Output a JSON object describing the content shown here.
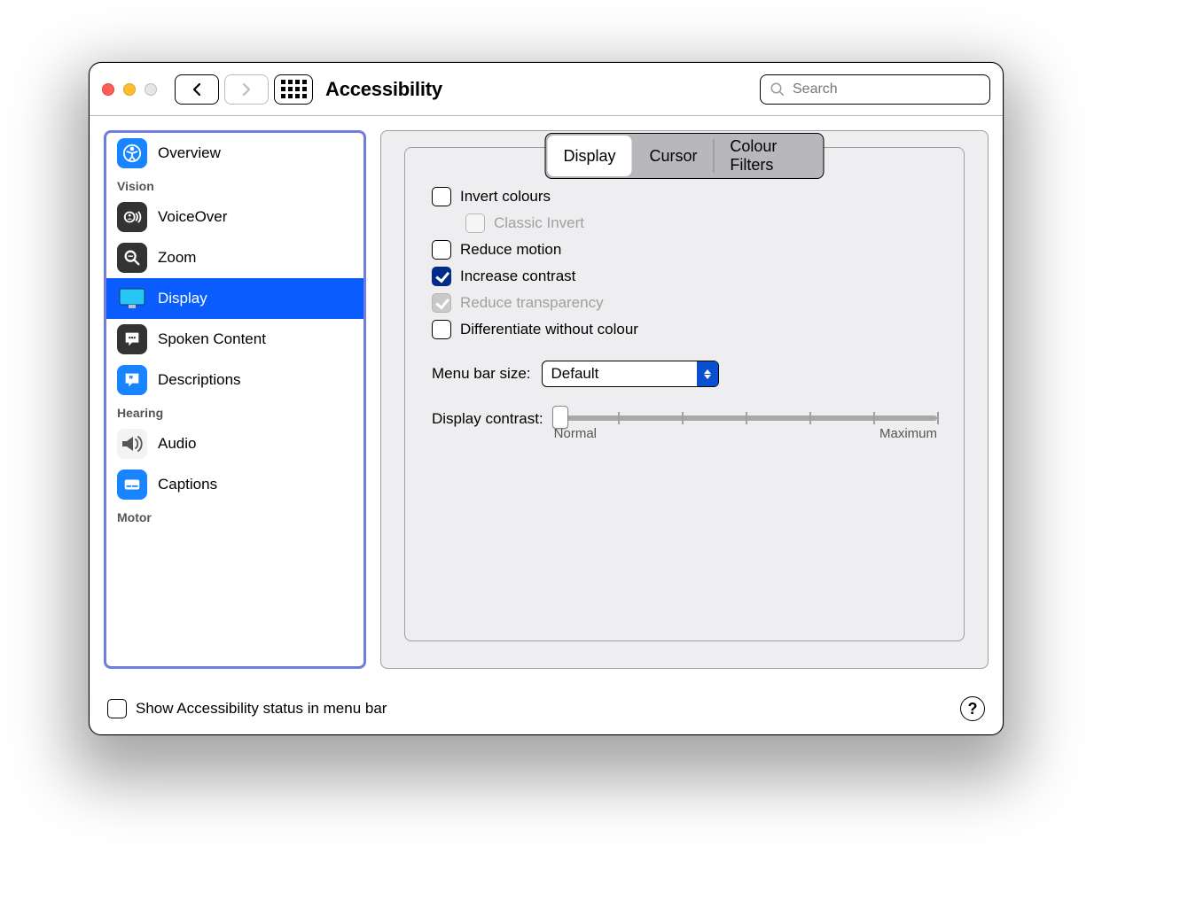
{
  "window": {
    "title": "Accessibility"
  },
  "search": {
    "placeholder": "Search"
  },
  "sidebar": {
    "sections": [
      {
        "items": [
          {
            "label": "Overview",
            "icon": "overview",
            "selected": false
          }
        ]
      },
      {
        "label": "Vision",
        "items": [
          {
            "label": "VoiceOver",
            "icon": "voiceover",
            "selected": false
          },
          {
            "label": "Zoom",
            "icon": "zoom",
            "selected": false
          },
          {
            "label": "Display",
            "icon": "display",
            "selected": true
          },
          {
            "label": "Spoken Content",
            "icon": "spoken",
            "selected": false
          },
          {
            "label": "Descriptions",
            "icon": "descriptions",
            "selected": false
          }
        ]
      },
      {
        "label": "Hearing",
        "items": [
          {
            "label": "Audio",
            "icon": "audio",
            "selected": false
          },
          {
            "label": "Captions",
            "icon": "captions",
            "selected": false
          }
        ]
      },
      {
        "label": "Motor",
        "items": []
      }
    ]
  },
  "tabs": [
    {
      "label": "Display",
      "selected": true
    },
    {
      "label": "Cursor",
      "selected": false
    },
    {
      "label": "Colour Filters",
      "selected": false
    }
  ],
  "options": {
    "invert_colours": {
      "label": "Invert colours",
      "checked": false
    },
    "classic_invert": {
      "label": "Classic Invert",
      "checked": false,
      "disabled": true
    },
    "reduce_motion": {
      "label": "Reduce motion",
      "checked": false
    },
    "increase_contrast": {
      "label": "Increase contrast",
      "checked": true
    },
    "reduce_transparency": {
      "label": "Reduce transparency",
      "checked": true,
      "disabled": true
    },
    "differentiate": {
      "label": "Differentiate without colour",
      "checked": false
    }
  },
  "menu_bar": {
    "label": "Menu bar size:",
    "value": "Default"
  },
  "contrast": {
    "label": "Display contrast:",
    "min_label": "Normal",
    "max_label": "Maximum"
  },
  "footer": {
    "show_status": {
      "label": "Show Accessibility status in menu bar",
      "checked": false
    }
  }
}
